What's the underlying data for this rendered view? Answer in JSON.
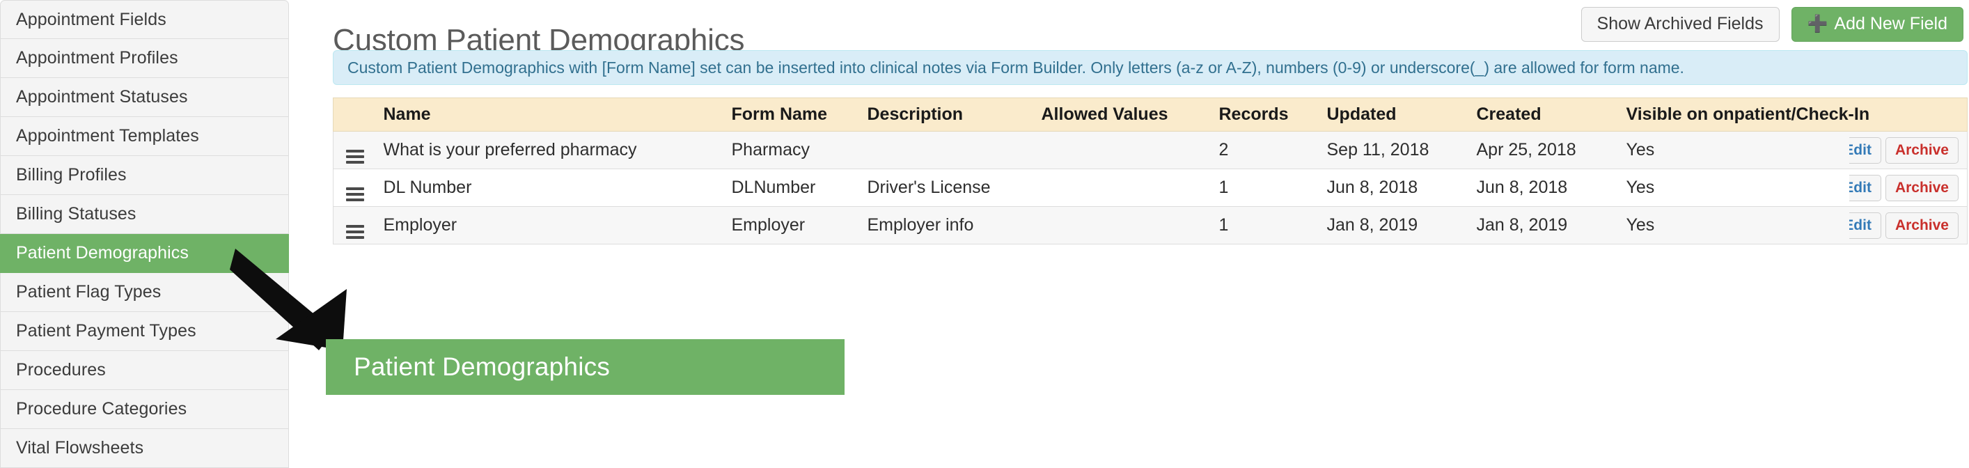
{
  "sidebar": {
    "items": [
      {
        "label": "Appointment Fields",
        "active": false
      },
      {
        "label": "Appointment Profiles",
        "active": false
      },
      {
        "label": "Appointment Statuses",
        "active": false
      },
      {
        "label": "Appointment Templates",
        "active": false
      },
      {
        "label": "Billing Profiles",
        "active": false
      },
      {
        "label": "Billing Statuses",
        "active": false
      },
      {
        "label": "Patient Demographics",
        "active": true
      },
      {
        "label": "Patient Flag Types",
        "active": false
      },
      {
        "label": "Patient Payment Types",
        "active": false
      },
      {
        "label": "Procedures",
        "active": false
      },
      {
        "label": "Procedure Categories",
        "active": false
      },
      {
        "label": "Vital Flowsheets",
        "active": false
      }
    ]
  },
  "header": {
    "title": "Custom Patient Demographics",
    "show_archived_label": "Show Archived Fields",
    "add_new_label": "Add New Field",
    "add_new_icon": "plus-icon"
  },
  "info_banner": {
    "text": "Custom Patient Demographics with [Form Name] set can be inserted into clinical notes via Form Builder. Only letters (a-z or A-Z), numbers (0-9) or underscore(_) are allowed for form name."
  },
  "table": {
    "columns": [
      "",
      "Name",
      "Form Name",
      "Description",
      "Allowed Values",
      "Records",
      "Updated",
      "Created",
      "Visible on onpatient/Check-In",
      ""
    ],
    "rows": [
      {
        "handle_icon": "drag-handle-icon",
        "name": "What is your preferred pharmacy",
        "form_name": "Pharmacy",
        "description": "",
        "allowed_values": "",
        "records": "2",
        "updated": "Sep 11, 2018",
        "created": "Apr 25, 2018",
        "visible": "Yes",
        "edit_label": "Edit",
        "archive_label": "Archive"
      },
      {
        "handle_icon": "drag-handle-icon",
        "name": "DL Number",
        "form_name": "DLNumber",
        "description": "Driver's License",
        "allowed_values": "",
        "records": "1",
        "updated": "Jun 8, 2018",
        "created": "Jun 8, 2018",
        "visible": "Yes",
        "edit_label": "Edit",
        "archive_label": "Archive"
      },
      {
        "handle_icon": "drag-handle-icon",
        "name": "Employer",
        "form_name": "Employer",
        "description": "Employer info",
        "allowed_values": "",
        "records": "1",
        "updated": "Jan 8, 2019",
        "created": "Jan 8, 2019",
        "visible": "Yes",
        "edit_label": "Edit",
        "archive_label": "Archive"
      }
    ]
  },
  "annotation": {
    "callout_label": "Patient Demographics",
    "arrow_icon": "arrow-down-right-icon"
  },
  "colors": {
    "brand_green": "#6fb266",
    "info_bg": "#d9edf7",
    "info_text": "#31708f",
    "table_header_bg": "#faebcc",
    "edit_blue": "#337ab7",
    "archive_red": "#c9302c"
  }
}
